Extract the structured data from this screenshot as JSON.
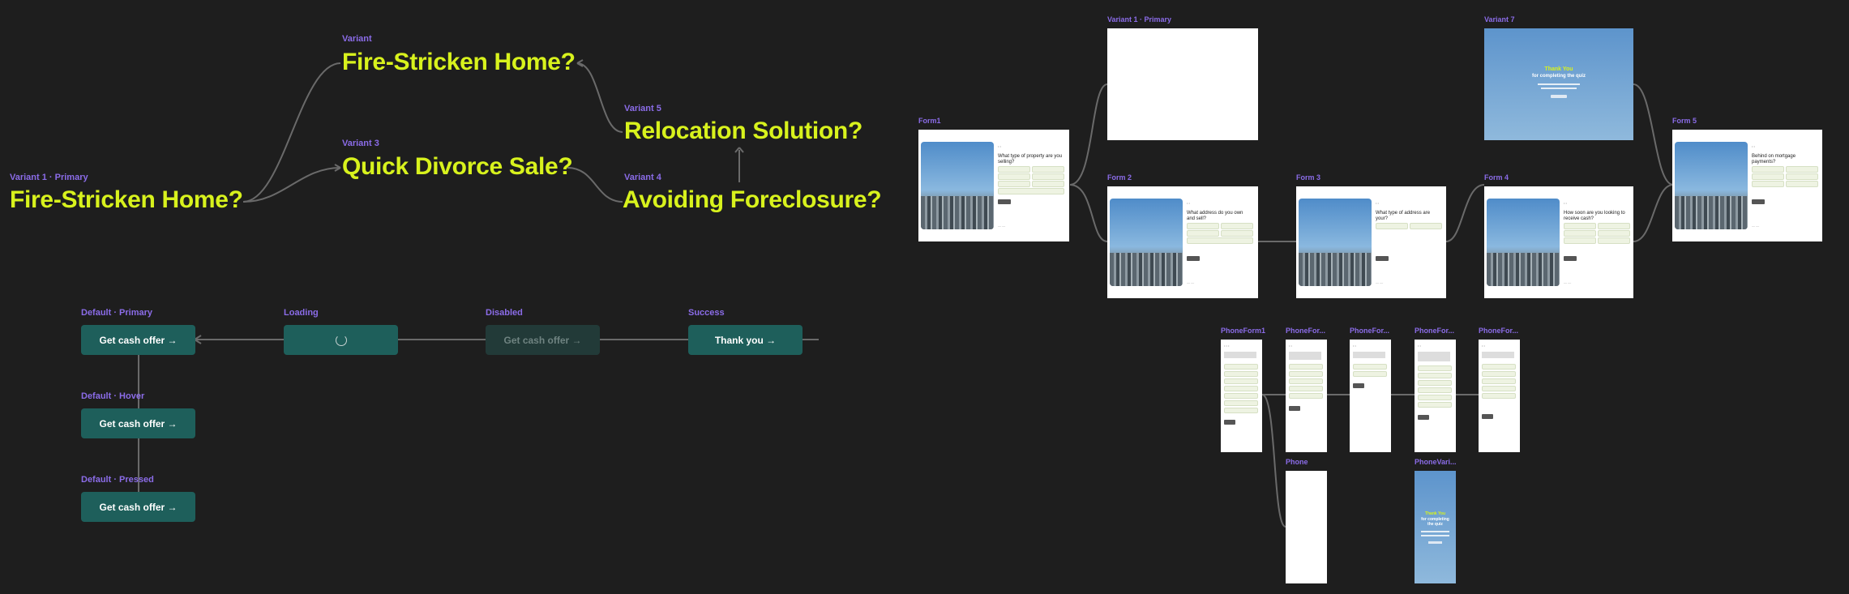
{
  "variants": {
    "variant1_label": "Variant 1 · Primary",
    "variant1_text": "Fire-Stricken Home?",
    "variant_label": "Variant",
    "variant_text": "Fire-Stricken Home?",
    "variant3_label": "Variant 3",
    "variant3_text": "Quick Divorce Sale?",
    "variant5_label": "Variant 5",
    "variant5_text": "Relocation Solution?",
    "variant4_label": "Variant 4",
    "variant4_text": "Avoiding Foreclosure?"
  },
  "buttons": {
    "default_primary_label": "Default · Primary",
    "default_primary_text": "Get cash offer →",
    "loading_label": "Loading",
    "disabled_label": "Disabled",
    "disabled_text": "Get cash offer →",
    "success_label": "Success",
    "success_text": "Thank you →",
    "default_hover_label": "Default · Hover",
    "default_hover_text": "Get cash offer   →",
    "default_pressed_label": "Default · Pressed",
    "default_pressed_text": "Get cash offer →"
  },
  "frames": {
    "variant1_primary": "Variant 1 · Primary",
    "variant7": "Variant 7",
    "form1": "Form1",
    "form2": "Form 2",
    "form3": "Form 3",
    "form4": "Form 4",
    "form5": "Form 5",
    "phoneform1": "PhoneForm1",
    "phonefor2": "PhoneFor...",
    "phonefor3": "PhoneFor...",
    "phonefor4": "PhoneFor...",
    "phonefor5": "PhoneFor...",
    "phone": "Phone",
    "phonevari": "PhoneVari..."
  },
  "frame_text": {
    "thank_title": "Thank You",
    "thank_sub": "for completing the quiz",
    "form1_q": "What type of property are you selling?",
    "form2_q": "What address do you own and sell?",
    "form3_q": "What type of address are your?",
    "form4_q": "How soon are you looking to receive cash?",
    "form5_q": "Behind on mortgage payments?"
  },
  "colors": {
    "canvas": "#1e1e1e",
    "label": "#8b6ce8",
    "headline": "#d8f21d",
    "button": "#1e5f5b",
    "wire": "#6e6e6e"
  }
}
